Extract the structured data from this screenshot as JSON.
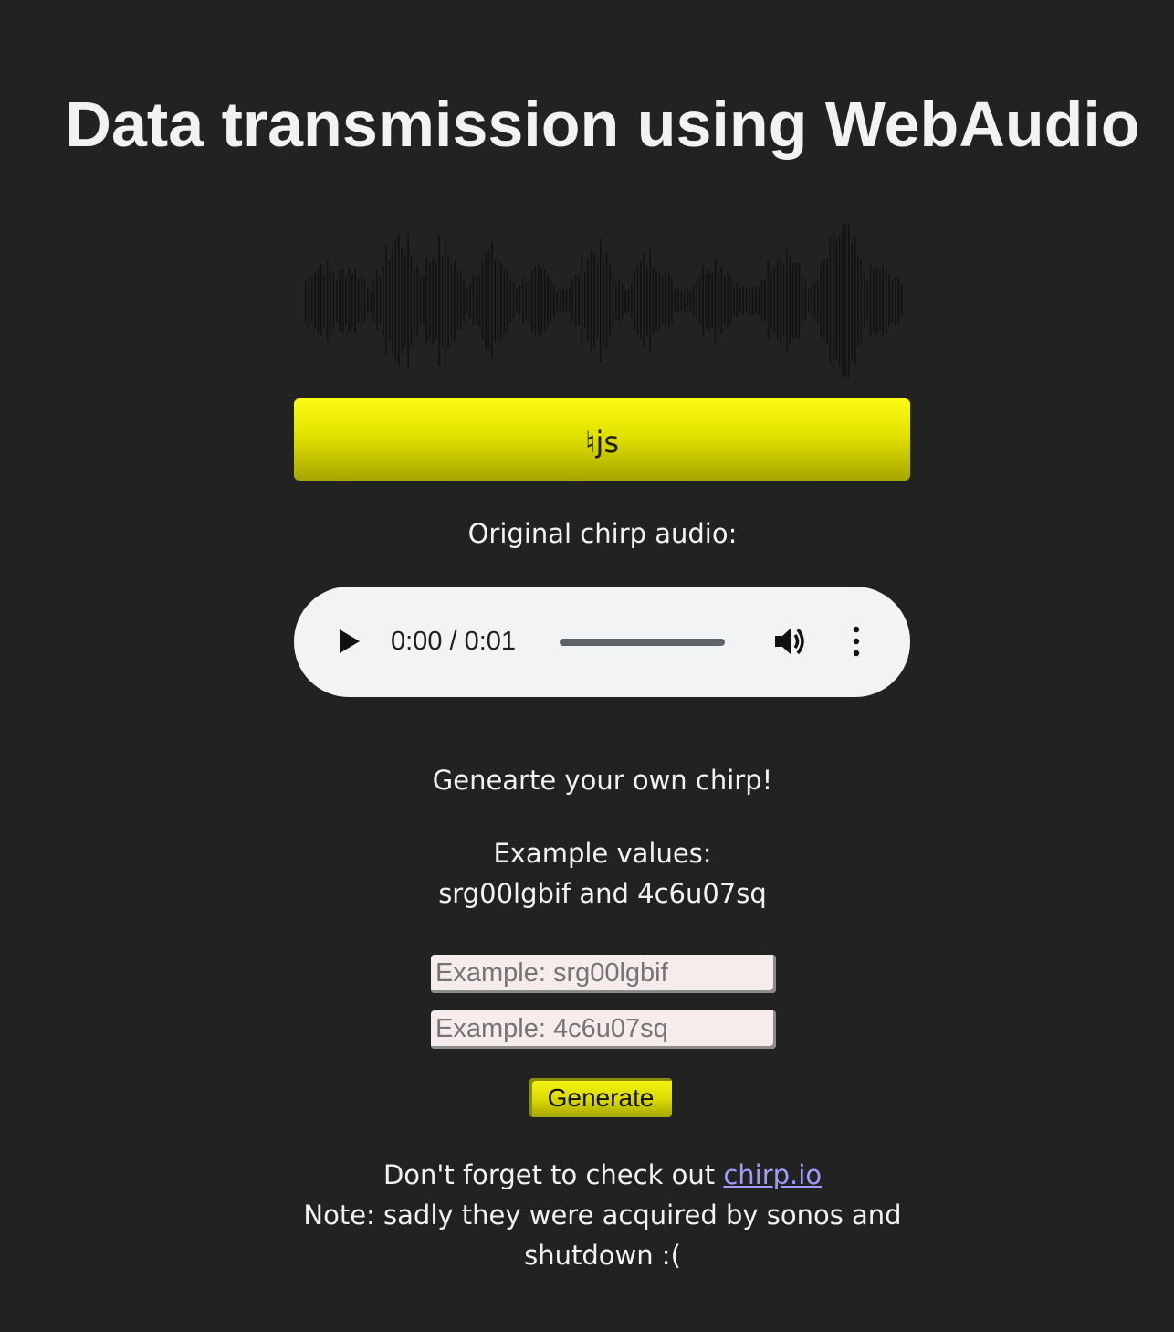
{
  "title": "Data transmission using WebAudio",
  "token_button": {
    "label": "♮js"
  },
  "original_audio_label": "Original chirp audio:",
  "player": {
    "time": "0:00 / 0:01",
    "play_icon": "play-icon",
    "volume_icon": "volume-icon",
    "more_icon": "more-vert-icon"
  },
  "generate_section": {
    "heading": "Genearte your own chirp!",
    "example_label": "Example values:",
    "example_values": "srg00lgbif and 4c6u07sq",
    "input1_placeholder": "Example: srg00lgbif",
    "input2_placeholder": "Example: 4c6u07sq",
    "button_label": "Generate"
  },
  "footer": {
    "line1_prefix": "Don't forget to check out ",
    "link_text": "chirp.io",
    "line2": "Note: sadly they were acquired by sonos and",
    "line3": "shutdown :("
  },
  "colors": {
    "background": "#222222",
    "accent_yellow": "#e2e200",
    "link": "#9d9dff"
  }
}
